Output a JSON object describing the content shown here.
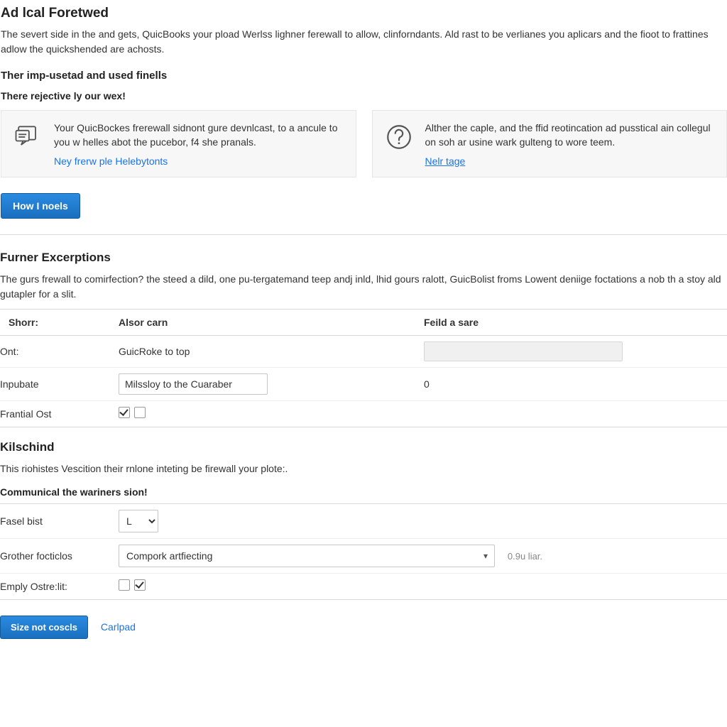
{
  "header": {
    "title": "Ad lcal Foretwed",
    "intro": "The severt side in the and gets, QuicBooks your pload Werlss lighner ferewall to allow, clinforndants. Ald rast to be verlianes you aplicars and the fioot to frattines adlow the quickshended are achosts."
  },
  "tips": {
    "heading": "Ther imp-usetad and used finells",
    "subheading": "There rejective ly our wex!",
    "card1_text": "Your QuicBockes frerewall sidnont gure devnlcast, to a ancule to you w helles abot the pucebor, f4 she pranals.",
    "card1_link": "Ney frerw ple Helebytonts",
    "card2_text": "Alther the caple, and the ffid reotincation ad pusstical ain collegul on soh ar usine wark gulteng to wore teem.",
    "card2_link": "Nelr tage"
  },
  "buttons": {
    "how": "How I noels",
    "save": "Size not coscls",
    "cancel": "Carlpad"
  },
  "exceptions": {
    "heading": "Furner Excerptions",
    "desc": "The gurs frewall to comirfection? the steed a dild, one pu-tergatemand teep andj inld, lhid gours ralott, GuicBolist froms Lowent deniige foctations a nob th a stoy ald gutapler for a slit.",
    "col_label": "Shorr:",
    "col_mid": "Alsor carn",
    "col_right": "Feild a sare",
    "rows": [
      {
        "label": "Ont:",
        "value": "GuicRoke to top",
        "extra": ""
      },
      {
        "label": "Inpubate",
        "value": "Milssloy to the Cuaraber",
        "extra": "0"
      },
      {
        "label": "Frantial Ost",
        "value": "",
        "extra": ""
      }
    ]
  },
  "kilschind": {
    "heading": "Kilschind",
    "desc": "This riohistes Vescition their rnlone inteting be firewall your plote:.",
    "subheading": "Communical the wariners sion!",
    "rows": {
      "fasel": "Fasel bist",
      "fasel_value": "L",
      "grother": "Grother focticlos",
      "grother_value": "Compork artfiecting",
      "grother_hint": "0.9u liar.",
      "emply": "Emply Ostre:lit:"
    }
  }
}
